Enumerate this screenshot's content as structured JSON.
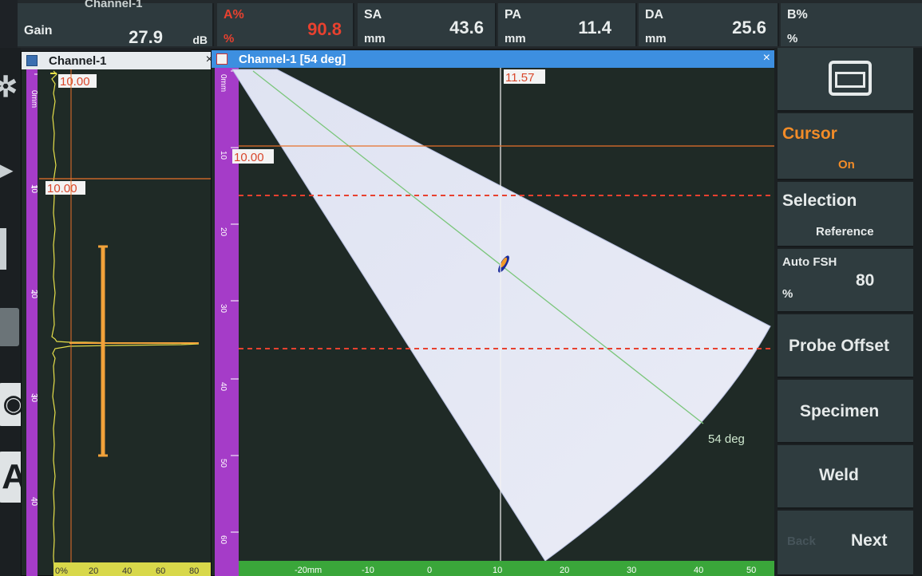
{
  "readouts": {
    "channel_title": "Channel-1",
    "gain": {
      "label": "Gain",
      "value": "27.9",
      "unit": "dB"
    },
    "a_pct": {
      "label": "A%",
      "value": "90.8",
      "unit": "%"
    },
    "sa": {
      "label": "SA",
      "value": "43.6",
      "unit": "mm"
    },
    "pa": {
      "label": "PA",
      "value": "11.4",
      "unit": "mm"
    },
    "da": {
      "label": "DA",
      "value": "25.6",
      "unit": "mm"
    },
    "b_pct": {
      "label": "B%",
      "value": "",
      "unit": "%"
    }
  },
  "ascan": {
    "title": "Channel-1",
    "close": "×",
    "depth_ticks": [
      "0mm",
      "10",
      "20",
      "30",
      "40"
    ],
    "amp_ticks": [
      "0%",
      "20",
      "40",
      "60",
      "80"
    ],
    "gate_label_top": "10.00",
    "gate_label_mid": "10.00"
  },
  "sscan": {
    "title": "Channel-1 [54 deg]",
    "close": "×",
    "depth_ticks": [
      "0mm",
      "10",
      "20",
      "30",
      "40",
      "50",
      "60"
    ],
    "x_ticks": [
      "-20mm",
      "-10",
      "0",
      "10",
      "20",
      "30",
      "40",
      "50"
    ],
    "cursor_v_label": "11.57",
    "cursor_h_label": "10.00",
    "angle_label": "54 deg"
  },
  "menu": {
    "cursor": {
      "label": "Cursor",
      "value": "On"
    },
    "selection": {
      "label": "Selection",
      "value": "Reference"
    },
    "auto_fsh": {
      "label": "Auto FSH",
      "unit": "%",
      "value": "80"
    },
    "probe_offset": "Probe Offset",
    "specimen": "Specimen",
    "weld": "Weld",
    "back": "Back",
    "next": "Next"
  },
  "colors": {
    "accent": "#3d8fe0",
    "gate": "#e8702a",
    "alarm": "#e8412f",
    "ruler_depth": "#a53cc8",
    "ruler_amp": "#d8d84a",
    "ruler_x": "#3aa63a"
  }
}
